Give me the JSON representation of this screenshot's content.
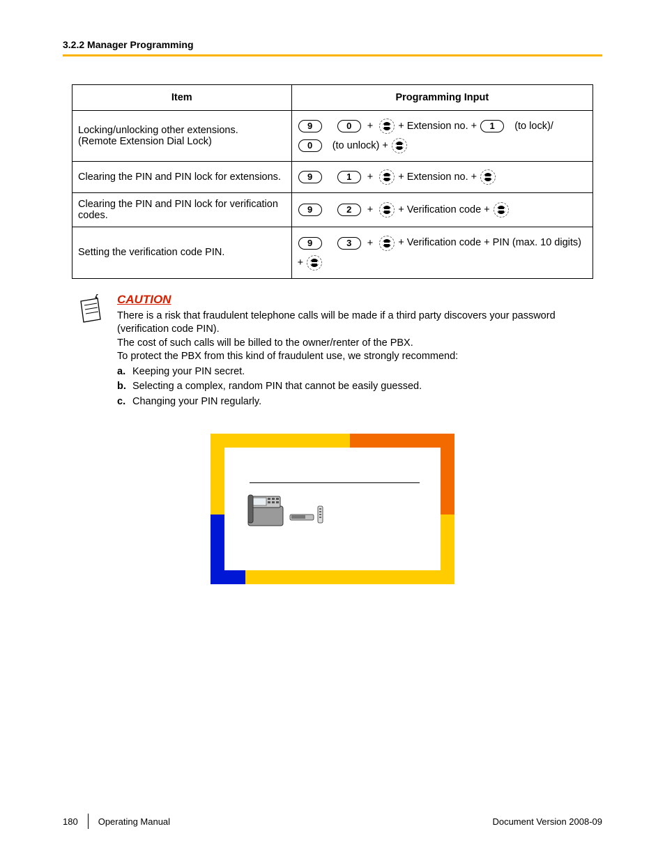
{
  "header": {
    "section": "3.2.2 Manager Programming"
  },
  "table": {
    "col_item": "Item",
    "col_input": "Programming Input",
    "rows": [
      {
        "item_l1": "Locking/unlocking other extensions.",
        "item_l2": "(Remote Extension Dial Lock)",
        "k1": "9",
        "k2": "0",
        "txt_ext": "+ Extension no. +",
        "k3": "1",
        "txt_lock": "(to lock)/",
        "k4": "0",
        "txt_unlock": "(to unlock) +"
      },
      {
        "item": "Clearing the PIN and PIN lock for extensions.",
        "k1": "9",
        "k2": "1",
        "txt": "+ Extension no. +"
      },
      {
        "item": "Clearing the PIN and PIN lock for verification codes.",
        "k1": "9",
        "k2": "2",
        "txt": "+ Verification code +"
      },
      {
        "item": "Setting the verification code PIN.",
        "k1": "9",
        "k2": "3",
        "txt": "+ Verification code + PIN (max. 10 digits)",
        "trail": "+"
      }
    ]
  },
  "caution": {
    "title": "CAUTION",
    "p1": "There is a risk that fraudulent telephone calls will be made if a third party discovers your password (verification code PIN).",
    "p2": "The cost of such calls will be billed to the owner/renter of the PBX.",
    "p3": "To protect the PBX from this kind of fraudulent use, we strongly recommend:",
    "items": [
      {
        "m": "a.",
        "t": "Keeping your PIN secret."
      },
      {
        "m": "b.",
        "t": "Selecting a complex, random PIN that cannot be easily guessed."
      },
      {
        "m": "c.",
        "t": "Changing your PIN regularly."
      }
    ]
  },
  "footer": {
    "page": "180",
    "manual": "Operating Manual",
    "version": "Document Version  2008-09"
  }
}
